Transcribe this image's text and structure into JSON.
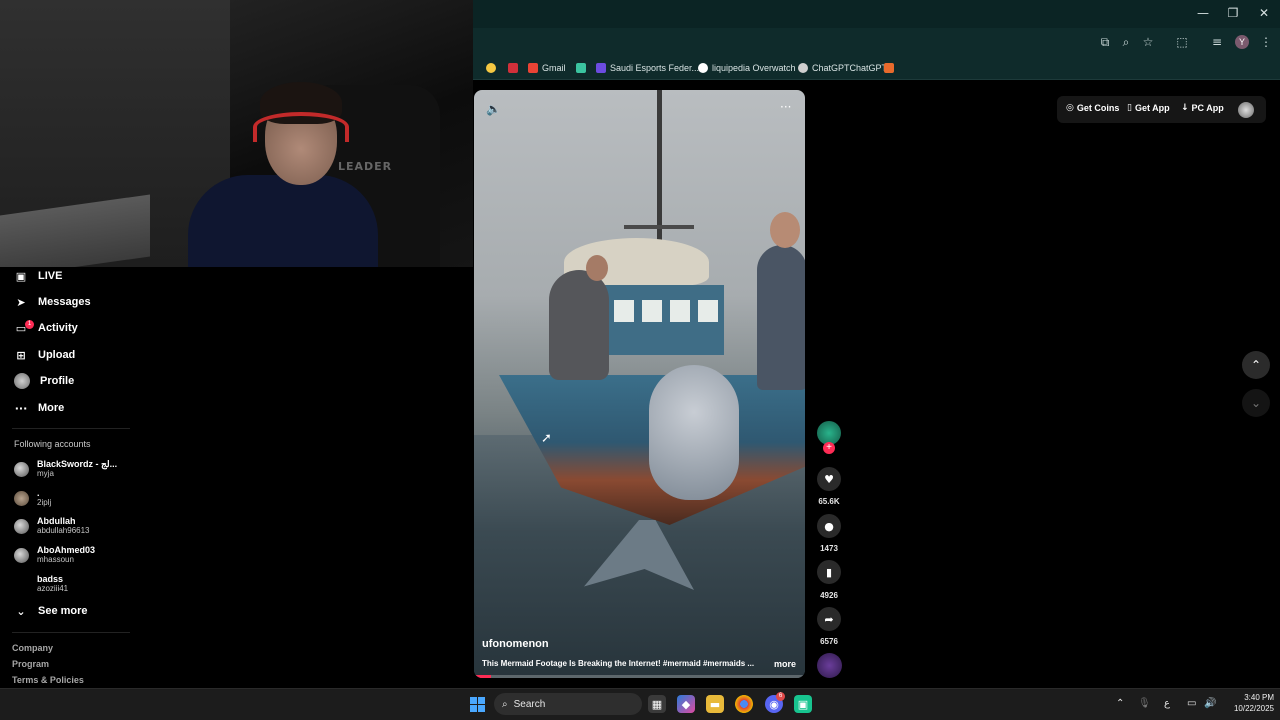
{
  "browser": {
    "window_controls": {
      "minimize": "—",
      "restore": "❐",
      "close": "✕"
    },
    "profile_initial": "Y",
    "bookmarks": [
      {
        "label": "",
        "icon": "lightbulb-icon",
        "color": "#f5c842"
      },
      {
        "label": "",
        "icon": "red-bookmark-icon",
        "color": "#d0303a"
      },
      {
        "label": "Gmail",
        "icon": "gmail-icon",
        "color": "#ea4335"
      },
      {
        "label": "",
        "icon": "lightning-icon",
        "color": "#3bc4a0"
      },
      {
        "label": "Saudi Esports Feder...",
        "icon": "esports-icon",
        "color": "#6c4ce0"
      },
      {
        "label": "liquipedia Overwatch",
        "icon": "liquipedia-icon",
        "color": "#ffffff"
      },
      {
        "label": "ChatGPTChatGPT",
        "icon": "chatgpt-icon",
        "color": "#cfcfcf"
      },
      {
        "label": "",
        "icon": "rocket-icon",
        "color": "#e86a2c"
      }
    ]
  },
  "webcam": {
    "chair_text": "LEADER"
  },
  "sidebar": {
    "items": [
      {
        "label": "LIVE",
        "icon": "live-icon"
      },
      {
        "label": "Messages",
        "icon": "messages-icon"
      },
      {
        "label": "Activity",
        "icon": "activity-icon",
        "badge": "1"
      },
      {
        "label": "Upload",
        "icon": "upload-icon"
      },
      {
        "label": "Profile",
        "icon": "profile-avatar"
      },
      {
        "label": "More",
        "icon": "more-icon"
      }
    ],
    "following_title": "Following accounts",
    "accounts": [
      {
        "name": "BlackSwordz - لج...",
        "handle": "myja"
      },
      {
        "name": ".",
        "handle": "2iplj"
      },
      {
        "name": "Abdullah",
        "handle": "abdullah96613"
      },
      {
        "name": "AboAhmed03",
        "handle": "mhassoun"
      },
      {
        "name": "badss",
        "handle": "azoziii41"
      }
    ],
    "see_more": "See more",
    "footer": [
      "Company",
      "Program",
      "Terms & Policies"
    ]
  },
  "video": {
    "author": "ufonomenon",
    "caption": "This Mermaid Footage Is Breaking the Internet! #mermaid #mermaids ...",
    "more": "more",
    "progress": 0.05
  },
  "actions": {
    "likes": "65.6K",
    "comments": "1473",
    "saves": "4926",
    "shares": "6576"
  },
  "header_chips": {
    "get_coins": "Get Coins",
    "get_app": "Get App",
    "pc_app": "PC App"
  },
  "taskbar": {
    "search_placeholder": "Search",
    "notification_count": "6",
    "lang": "ع",
    "time": "3:40 PM",
    "date": "10/22/2025"
  },
  "colors": {
    "accent": "#fe2c55",
    "chrome_bg": "#0f2b2b",
    "page_bg": "#000000"
  }
}
